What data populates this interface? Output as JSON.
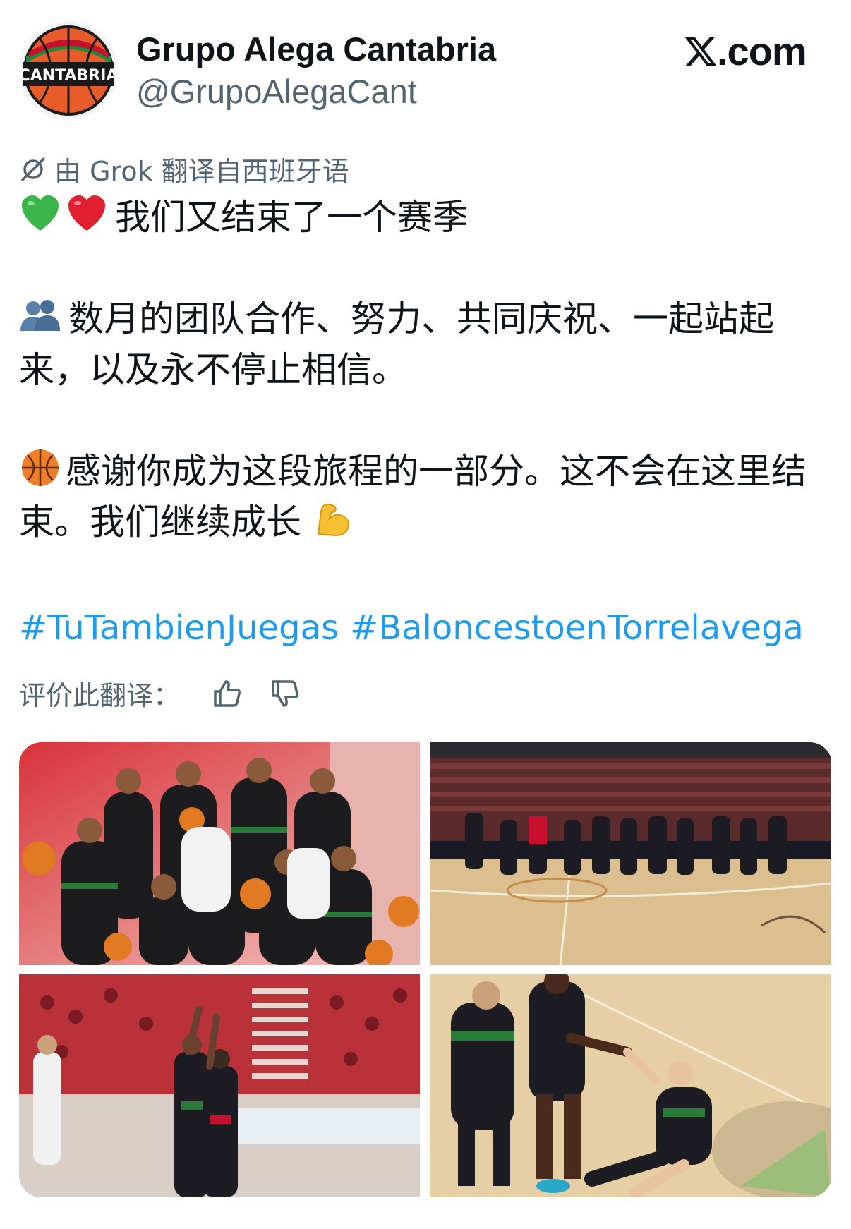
{
  "header": {
    "display_name": "Grupo Alega Cantabria",
    "handle": "@GrupoAlegaCant",
    "avatar_text": "CANTABRIA",
    "site_label": ".com"
  },
  "translation": {
    "note": "由 Grok 翻译自西班牙语",
    "rate_label": "评价此翻译："
  },
  "tweet": {
    "line1": "我们又结束了一个赛季",
    "para2": "数月的团队合作、努力、共同庆祝、一起站起来，以及永不停止相信。",
    "para3": "感谢你成为这段旅程的一部分。这不会在这里结束。我们继续成长",
    "hashtags": [
      "#TuTambienJuegas",
      "#BaloncestoenTorrelavega"
    ]
  },
  "icons": {
    "emoji": [
      "green-heart-icon",
      "red-heart-icon",
      "people-icon",
      "basketball-icon",
      "flexed-biceps-icon"
    ],
    "other": [
      "grok-icon",
      "thumbs-up-icon",
      "thumbs-down-icon",
      "x-logo-icon"
    ]
  },
  "colors": {
    "link": "#1d9bf0",
    "secondary_text": "#536471",
    "team_red": "#c8102e",
    "team_green": "#1f8a3c"
  }
}
